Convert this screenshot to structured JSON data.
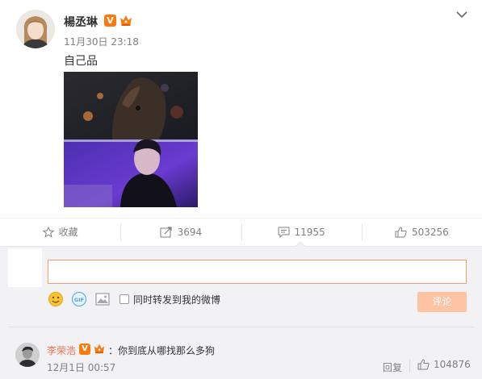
{
  "post": {
    "author": "楊丞琳",
    "verified_badge": "V",
    "time": "11月30日 23:18",
    "text": "自己品"
  },
  "actions": {
    "favorite_label": "收藏",
    "repost_count": "3694",
    "comment_count": "11955",
    "like_count": "503256"
  },
  "comment_box": {
    "value": "",
    "forward_label": "同时转发到我的微博",
    "submit_label": "评论"
  },
  "comments": [
    {
      "user": "李荣浩",
      "badge": "V",
      "text": "：你到底从哪找那么多狗",
      "time": "12月1日 00:57",
      "reply_label": "回复",
      "like_count": "104876"
    }
  ],
  "colors": {
    "accent": "#eb7350",
    "verified": "#f77b0f",
    "submit_disabled": "#fdc3a3",
    "input_border": "#f29f6c"
  }
}
